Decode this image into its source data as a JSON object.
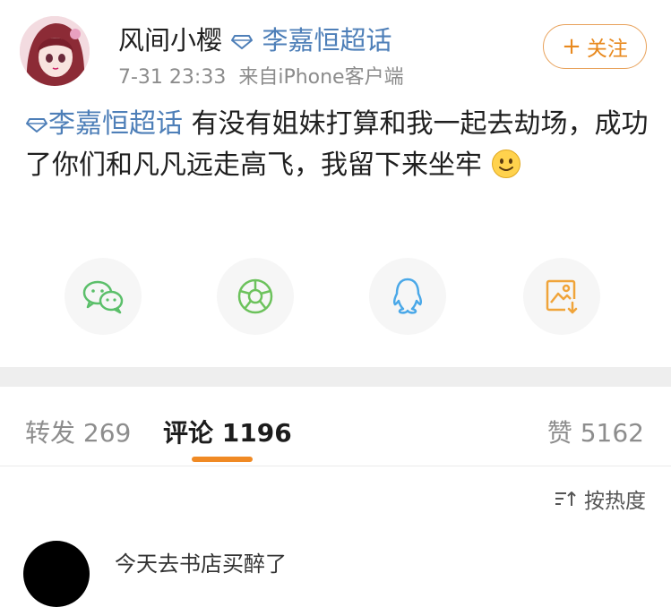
{
  "post": {
    "username": "风间小樱",
    "topic_tag": "李嘉恒超话",
    "timestamp": "7-31 23:33",
    "source": "来自iPhone客户端",
    "follow_label": "+关注",
    "follow_text": "关注",
    "content_topic": "李嘉恒超话",
    "content_text": " 有没有姐妹打算和我一起去劫场，成功了你们和凡凡远走高飞，我留下来坐牢"
  },
  "share": {
    "icons": [
      "wechat-icon",
      "moments-icon",
      "qq-icon",
      "save-image-icon"
    ]
  },
  "tabs": {
    "repost_label": "转发",
    "repost_count": "269",
    "comment_label": "评论",
    "comment_count": "1196",
    "like_label": "赞",
    "like_count": "5162"
  },
  "sort": {
    "label": "按热度"
  },
  "comment": {
    "text": "今天去书店买醉了"
  },
  "colors": {
    "accent": "#f08a24",
    "link": "#4e7fb8",
    "wechat": "#5bbf6a",
    "moments": "#6cc25c",
    "qq": "#4aa8e8",
    "save": "#f0a43a"
  }
}
